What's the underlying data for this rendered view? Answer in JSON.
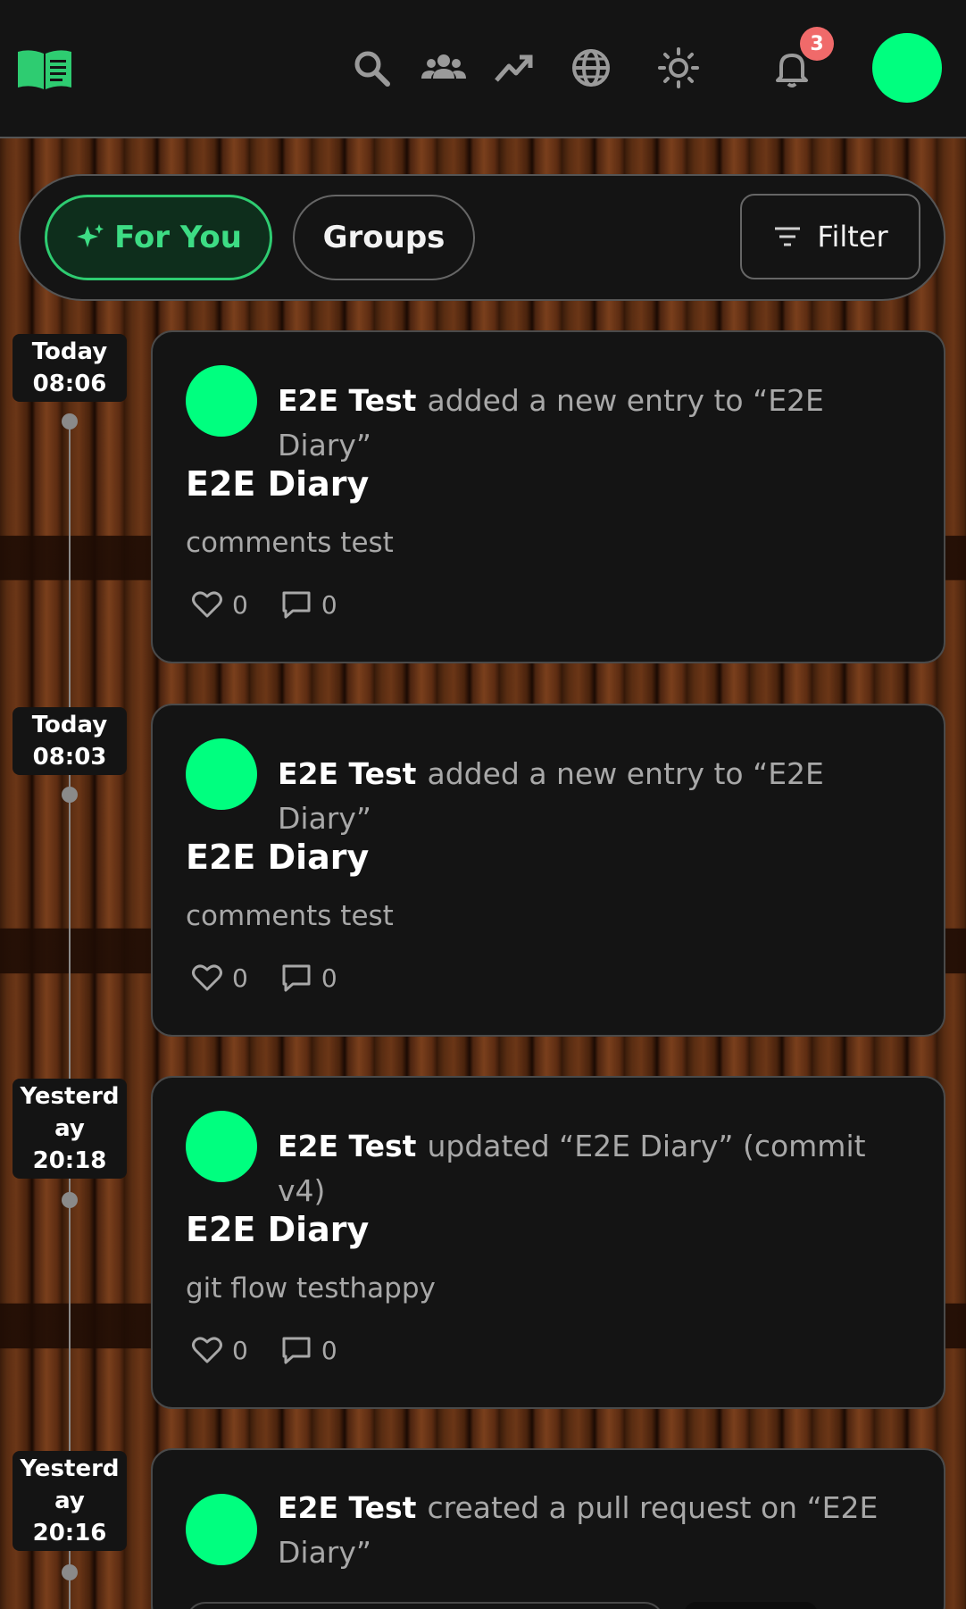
{
  "header": {
    "logo_icon": "open-book-icon",
    "nav_icons": [
      "search-icon",
      "groups-icon",
      "trending-icon",
      "globe-icon",
      "sun-icon"
    ],
    "notification_count": "3",
    "colors": {
      "accent": "#00ff7f",
      "badge": "#f06a6a",
      "bar": "#141414"
    }
  },
  "tabs": {
    "for_you": "For You",
    "groups": "Groups",
    "filter": "Filter",
    "active": "For You"
  },
  "feed": [
    {
      "time_day": "Today",
      "time_clock": "08:06",
      "user": "E2E Test",
      "action": "added a new entry to “E2E Diary”",
      "title": "E2E Diary",
      "snippet": "comments test",
      "likes": "0",
      "comments": "0"
    },
    {
      "time_day": "Today",
      "time_clock": "08:03",
      "user": "E2E Test",
      "action": "added a new entry to “E2E Diary”",
      "title": "E2E Diary",
      "snippet": "comments test",
      "likes": "0",
      "comments": "0"
    },
    {
      "time_day_line1": "Yesterd",
      "time_day_line2": "ay",
      "time_clock": "20:18",
      "user": "E2E Test",
      "action": "updated “E2E Diary” (commit v4)",
      "title": "E2E Diary",
      "snippet": "git flow testhappy",
      "likes": "0",
      "comments": "0"
    },
    {
      "time_day_line1": "Yesterd",
      "time_day_line2": "ay",
      "time_clock": "20:16",
      "user": "E2E Test",
      "action": "created a pull request on “E2E Diary”"
    }
  ]
}
